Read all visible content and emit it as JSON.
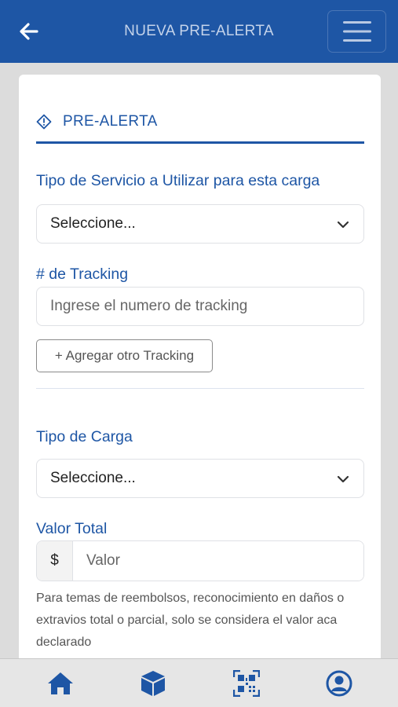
{
  "header": {
    "title": "NUEVA PRE-ALERTA",
    "back_icon": "arrow-left-icon",
    "menu_icon": "hamburger-icon"
  },
  "form": {
    "section_title": "PRE-ALERTA",
    "section_icon": "warning-diamond-icon",
    "service_label": "Tipo de Servicio a Utilizar para esta carga",
    "service_value": "Seleccione...",
    "tracking_label": "# de Tracking",
    "tracking_placeholder": "Ingrese el numero de tracking",
    "tracking_value": "",
    "add_tracking_label": "+ Agregar otro Tracking",
    "cargo_label": "Tipo de Carga",
    "cargo_value": "Seleccione...",
    "value_label": "Valor Total",
    "currency_symbol": "$",
    "value_placeholder": "Valor",
    "value_value": "",
    "help_text": "Para temas de reembolsos, reconocimiento en daños o extravios total o parcial, solo se considera el valor aca declarado"
  },
  "bottom_nav": {
    "items": [
      {
        "icon": "home-icon"
      },
      {
        "icon": "package-icon"
      },
      {
        "icon": "qr-code-icon"
      },
      {
        "icon": "user-circle-icon"
      }
    ]
  },
  "colors": {
    "primary": "#1e56a5",
    "background": "#dcdcdc",
    "nav_background": "#e6e6e6"
  }
}
